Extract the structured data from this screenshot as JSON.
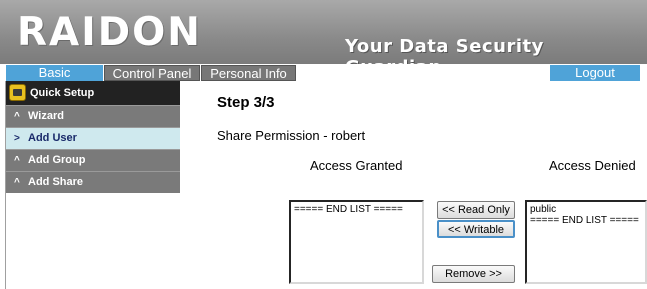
{
  "header": {
    "logo": "RAIDON",
    "tagline": "Your Data Security Guardian."
  },
  "tabs": {
    "basic": "Basic",
    "control_panel": "Control Panel",
    "personal_info": "Personal Info",
    "logout": "Logout"
  },
  "sidebar": {
    "quick_setup": "Quick Setup",
    "items": [
      {
        "arrow": "^",
        "label": "Wizard"
      },
      {
        "arrow": ">",
        "label": "Add User"
      },
      {
        "arrow": "^",
        "label": "Add Group"
      },
      {
        "arrow": "^",
        "label": "Add Share"
      }
    ],
    "active_index": 1
  },
  "content": {
    "step": "Step 3/3",
    "share_permission": "Share Permission - robert",
    "access_granted": "Access Granted",
    "access_denied": "Access Denied",
    "granted_list": [
      "===== END LIST ====="
    ],
    "denied_list": [
      "public",
      "===== END LIST ====="
    ],
    "read_only_button": "<< Read Only",
    "writable_button": "<< Writable",
    "remove_button": "Remove >>"
  },
  "colors": {
    "tab_active": "#4fa3d8",
    "tab_inactive": "#777777",
    "sidebar_dark": "#222222",
    "sidebar_item": "#7a7a7a",
    "sidebar_active": "#cfe9ee"
  }
}
